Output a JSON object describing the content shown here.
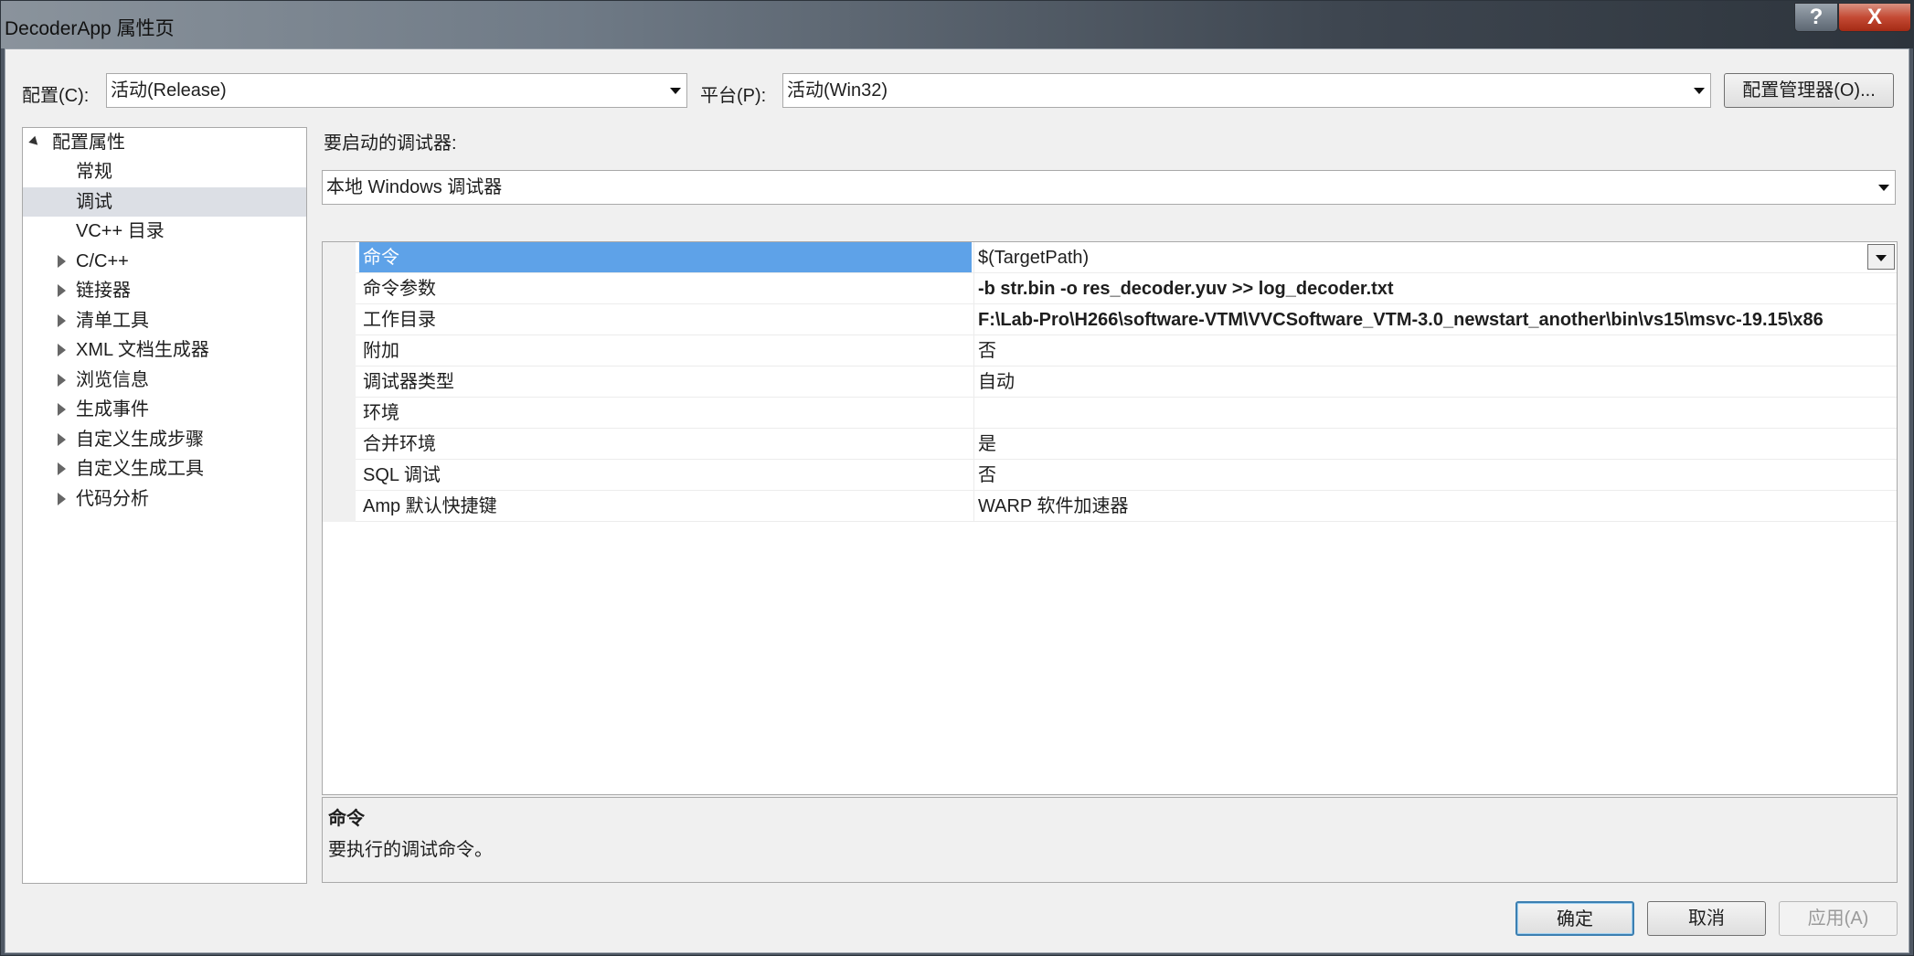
{
  "window": {
    "title": "DecoderApp 属性页",
    "help_glyph": "?",
    "close_glyph": "X"
  },
  "toolbar": {
    "config_label": "配置(C):",
    "config_value": "活动(Release)",
    "platform_label": "平台(P):",
    "platform_value": "活动(Win32)",
    "config_manager_button": "配置管理器(O)..."
  },
  "tree": {
    "items": [
      {
        "label": "配置属性",
        "state": "expanded",
        "level": 0
      },
      {
        "label": "常规",
        "state": "leaf",
        "level": 1
      },
      {
        "label": "调试",
        "state": "leaf-selected",
        "level": 1
      },
      {
        "label": "VC++ 目录",
        "state": "leaf",
        "level": 1
      },
      {
        "label": "C/C++",
        "state": "collapsed",
        "level": 1
      },
      {
        "label": "链接器",
        "state": "collapsed",
        "level": 1
      },
      {
        "label": "清单工具",
        "state": "collapsed",
        "level": 1
      },
      {
        "label": "XML 文档生成器",
        "state": "collapsed",
        "level": 1
      },
      {
        "label": "浏览信息",
        "state": "collapsed",
        "level": 1
      },
      {
        "label": "生成事件",
        "state": "collapsed",
        "level": 1
      },
      {
        "label": "自定义生成步骤",
        "state": "collapsed",
        "level": 1
      },
      {
        "label": "自定义生成工具",
        "state": "collapsed",
        "level": 1
      },
      {
        "label": "代码分析",
        "state": "collapsed",
        "level": 1
      }
    ]
  },
  "debugger": {
    "label": "要启动的调试器:",
    "value": "本地 Windows 调试器"
  },
  "properties": [
    {
      "name": "命令",
      "value": "$(TargetPath)",
      "bold": false,
      "selected": true
    },
    {
      "name": "命令参数",
      "value": "-b str.bin -o res_decoder.yuv >> log_decoder.txt",
      "bold": true,
      "selected": false
    },
    {
      "name": "工作目录",
      "value": "F:\\Lab-Pro\\H266\\software-VTM\\VVCSoftware_VTM-3.0_newstart_another\\bin\\vs15\\msvc-19.15\\x86",
      "bold": true,
      "selected": false
    },
    {
      "name": "附加",
      "value": "否",
      "bold": false,
      "selected": false
    },
    {
      "name": "调试器类型",
      "value": "自动",
      "bold": false,
      "selected": false
    },
    {
      "name": "环境",
      "value": "",
      "bold": false,
      "selected": false
    },
    {
      "name": "合并环境",
      "value": "是",
      "bold": false,
      "selected": false
    },
    {
      "name": "SQL 调试",
      "value": "否",
      "bold": false,
      "selected": false
    },
    {
      "name": "Amp 默认快捷键",
      "value": "WARP 软件加速器",
      "bold": false,
      "selected": false
    }
  ],
  "description": {
    "title": "命令",
    "text": "要执行的调试命令。"
  },
  "buttons": {
    "ok": "确定",
    "cancel": "取消",
    "apply": "应用(A)"
  }
}
